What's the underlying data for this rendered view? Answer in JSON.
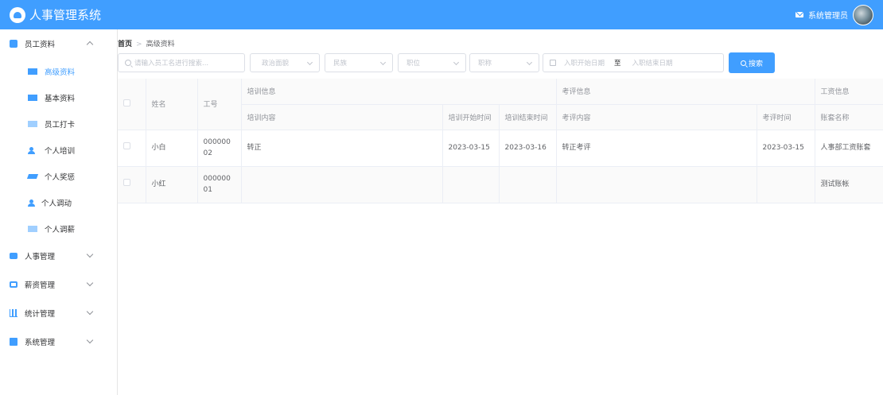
{
  "app": {
    "title": "人事管理系统",
    "user_name": "系统管理员"
  },
  "sidebar": {
    "groups": [
      {
        "label": "员工资料",
        "icon": "user-circle-icon",
        "expanded": true,
        "items": [
          {
            "label": "高级资料",
            "icon": "id-card-icon",
            "active": true
          },
          {
            "label": "基本资料",
            "icon": "id-card-icon"
          },
          {
            "label": "员工打卡",
            "icon": "id-card-icon"
          },
          {
            "label": "个人培训",
            "icon": "users-icon"
          },
          {
            "label": "个人奖惩",
            "icon": "award-icon"
          },
          {
            "label": "个人调动",
            "icon": "person-icon"
          },
          {
            "label": "个人调薪",
            "icon": "id-card-icon"
          }
        ]
      },
      {
        "label": "人事管理",
        "icon": "id-card-icon"
      },
      {
        "label": "薪资管理",
        "icon": "money-icon"
      },
      {
        "label": "统计管理",
        "icon": "bar-chart-icon"
      },
      {
        "label": "系统管理",
        "icon": "windows-icon"
      }
    ]
  },
  "breadcrumb": {
    "home": "首页",
    "current": "高级资料"
  },
  "filters": {
    "search_placeholder": "请输入员工名进行搜索...",
    "politic_placeholder": "政治面貌",
    "nation_placeholder": "民族",
    "position_placeholder": "职位",
    "title_placeholder": "职称",
    "start_date_placeholder": "入职开始日期",
    "range_separator": "至",
    "end_date_placeholder": "入职结束日期",
    "search_button": "搜索"
  },
  "table": {
    "headers": {
      "name": "姓名",
      "work_id": "工号",
      "training_group": "培训信息",
      "appraisal_group": "考评信息",
      "salary_group": "工资信息",
      "training_content": "培训内容",
      "training_start": "培训开始时间",
      "training_end": "培训结束时间",
      "appraisal_content": "考评内容",
      "appraisal_time": "考评时间",
      "account_name": "账套名称"
    },
    "rows": [
      {
        "name": "小白",
        "work_id": "00000002",
        "training_content": "转正",
        "training_start": "2023-03-15",
        "training_end": "2023-03-16",
        "appraisal_content": "转正考评",
        "appraisal_time": "2023-03-15",
        "account_name": "人事部工资账套"
      },
      {
        "name": "小红",
        "work_id": "00000001",
        "training_content": "",
        "training_start": "",
        "training_end": "",
        "appraisal_content": "",
        "appraisal_time": "",
        "account_name": "测试账帐"
      }
    ]
  }
}
